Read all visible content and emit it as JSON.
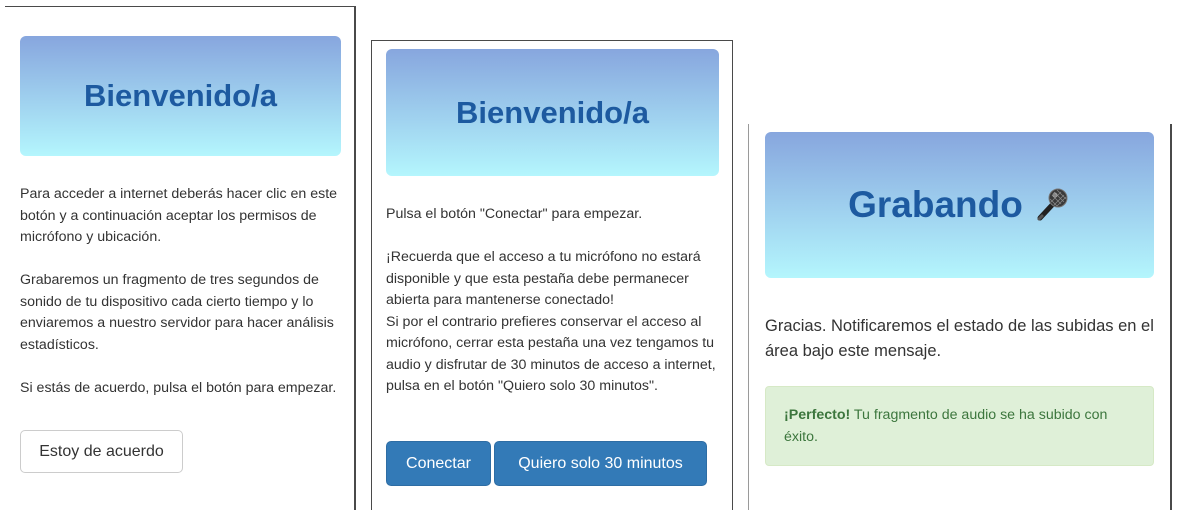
{
  "panel1": {
    "title": "Bienvenido/a",
    "paragraph1": "Para acceder a internet deberás hacer clic en este botón y a continuación aceptar los permisos de micrófono y ubicación.",
    "paragraph2": "Grabaremos un fragmento de tres segundos de sonido de tu dispositivo cada cierto tiempo y lo enviaremos a nuestro servidor para hacer análisis estadísticos.",
    "paragraph3": "Si estás de acuerdo, pulsa el botón para empezar.",
    "agree_button": "Estoy de acuerdo"
  },
  "panel2": {
    "title": "Bienvenido/a",
    "paragraph1": "Pulsa el botón \"Conectar\" para empezar.",
    "paragraph2": "¡Recuerda que el acceso a tu micrófono no estará disponible y que esta pestaña debe permanecer abierta para mantenerse conectado!",
    "paragraph3": "Si por el contrario prefieres conservar el acceso al micrófono, cerrar esta pestaña una vez tengamos tu audio y disfrutar de 30 minutos de acceso a internet, pulsa en el botón \"Quiero solo 30 minutos\".",
    "connect_button": "Conectar",
    "thirty_button": "Quiero solo 30 minutos"
  },
  "panel3": {
    "title": "Grabando",
    "title_icon": "microphone-icon",
    "message": "Gracias. Notificaremos el estado de las subidas en el área bajo este mensaje.",
    "alert_strong": "¡Perfecto!",
    "alert_text": " Tu fragmento de audio se ha subido con éxito."
  },
  "colors": {
    "title_blue": "#1d5aa0",
    "gradient_top": "#87a6de",
    "gradient_bottom": "#b4f6fd",
    "primary": "#337ab7",
    "success_bg": "#dff0d8",
    "success_text": "#3c763d"
  }
}
